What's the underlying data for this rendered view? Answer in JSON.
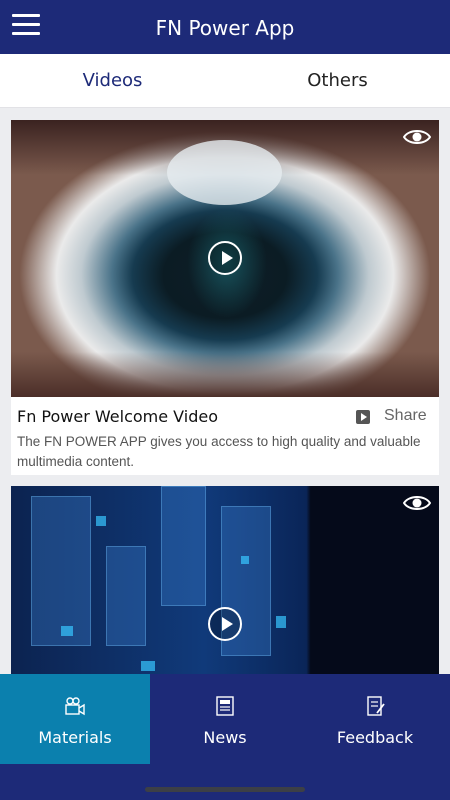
{
  "app": {
    "title": "FN Power App"
  },
  "tabs": [
    {
      "label": "Videos",
      "active": true
    },
    {
      "label": "Others",
      "active": false
    }
  ],
  "videos": [
    {
      "title": "Fn Power Welcome Video",
      "share_label": "Share",
      "description": "The FN POWER APP gives you access to high quality and valuable multimedia content."
    }
  ],
  "bottom_nav": [
    {
      "label": "Materials",
      "icon": "video-camera-icon",
      "active": true
    },
    {
      "label": "News",
      "icon": "newspaper-icon",
      "active": false
    },
    {
      "label": "Feedback",
      "icon": "feedback-icon",
      "active": false
    }
  ],
  "colors": {
    "primary": "#1d2a78",
    "active_nav": "#0b80ae"
  }
}
